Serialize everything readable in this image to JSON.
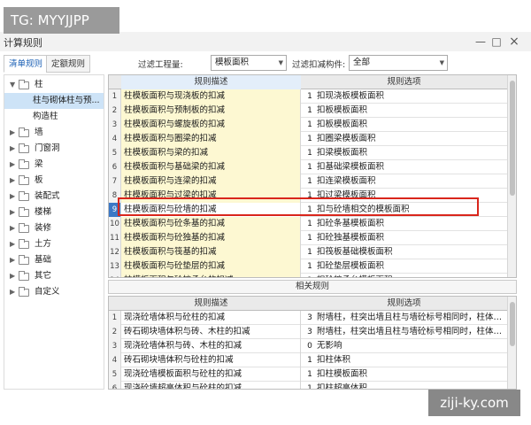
{
  "watermarks": {
    "top_left": "TG: MYYJJPP",
    "bottom_right": "ziji-ky.com"
  },
  "window": {
    "title": "计算规则",
    "minimize": "—",
    "maximize": "□",
    "close": "×"
  },
  "tabs": [
    {
      "label": "清单规则",
      "active": true
    },
    {
      "label": "定额规则",
      "active": false
    }
  ],
  "filters": {
    "project_label": "过滤工程量:",
    "project_value": "模板面积",
    "member_label": "过滤扣减构件:",
    "member_value": "全部"
  },
  "tree": [
    {
      "label": "柱",
      "expanded": true,
      "children": [
        {
          "label": "柱与砌体柱与预...",
          "selected": true
        },
        {
          "label": "构造柱"
        }
      ]
    },
    {
      "label": "墙"
    },
    {
      "label": "门窗洞"
    },
    {
      "label": "梁"
    },
    {
      "label": "板"
    },
    {
      "label": "装配式"
    },
    {
      "label": "楼梯"
    },
    {
      "label": "装修"
    },
    {
      "label": "土方"
    },
    {
      "label": "基础"
    },
    {
      "label": "其它"
    },
    {
      "label": "自定义"
    }
  ],
  "upper_grid": {
    "headers": {
      "description": "规则描述",
      "option": "规则选项"
    },
    "selected_row": 9,
    "rows": [
      {
        "num": "1",
        "desc": "柱模板面积与现浇板的扣减",
        "code": "1",
        "option": "扣现浇板模板面积"
      },
      {
        "num": "2",
        "desc": "柱模板面积与预制板的扣减",
        "code": "1",
        "option": "扣板模板面积"
      },
      {
        "num": "3",
        "desc": "柱模板面积与螺旋板的扣减",
        "code": "1",
        "option": "扣板模板面积"
      },
      {
        "num": "4",
        "desc": "柱模板面积与圈梁的扣减",
        "code": "1",
        "option": "扣圈梁模板面积"
      },
      {
        "num": "5",
        "desc": "柱模板面积与梁的扣减",
        "code": "1",
        "option": "扣梁模板面积"
      },
      {
        "num": "6",
        "desc": "柱模板面积与基础梁的扣减",
        "code": "1",
        "option": "扣基础梁模板面积"
      },
      {
        "num": "7",
        "desc": "柱模板面积与连梁的扣减",
        "code": "1",
        "option": "扣连梁模板面积"
      },
      {
        "num": "8",
        "desc": "柱模板面积与过梁的扣减",
        "code": "1",
        "option": "扣过梁模板面积"
      },
      {
        "num": "9",
        "desc": "柱模板面积与砼墙的扣减",
        "code": "1",
        "option": "扣与砼墙相交的模板面积"
      },
      {
        "num": "10",
        "desc": "柱模板面积与砼条基的扣减",
        "code": "1",
        "option": "扣砼条基模板面积"
      },
      {
        "num": "11",
        "desc": "柱模板面积与砼独基的扣减",
        "code": "1",
        "option": "扣砼独基模板面积"
      },
      {
        "num": "12",
        "desc": "柱模板面积与筏基的扣减",
        "code": "1",
        "option": "扣筏板基础模板面积"
      },
      {
        "num": "13",
        "desc": "柱模板面积与砼垫层的扣减",
        "code": "1",
        "option": "扣砼垫层模板面积"
      },
      {
        "num": "14",
        "desc": "柱模板面积与砼桩承台的扣减",
        "code": "1",
        "option": "扣砼桩承台模板面积"
      }
    ]
  },
  "related_label": "相关规则",
  "lower_grid": {
    "headers": {
      "description": "规则描述",
      "option": "规则选项"
    },
    "rows": [
      {
        "num": "1",
        "desc": "现浇砼墙体积与砼柱的扣减",
        "code": "3",
        "option": "附墙柱，柱突出墙且柱与墙砼标号相同时，柱体积并..."
      },
      {
        "num": "2",
        "desc": "砖石砌块墙体积与砖、木柱的扣减",
        "code": "3",
        "option": "附墙柱，柱突出墙且柱与墙砼标号相同时，柱体积并..."
      },
      {
        "num": "3",
        "desc": "现浇砼墙体积与砖、木柱的扣减",
        "code": "0",
        "option": "无影响"
      },
      {
        "num": "4",
        "desc": "砖石砌块墙体积与砼柱的扣减",
        "code": "1",
        "option": "扣柱体积"
      },
      {
        "num": "5",
        "desc": "现浇砼墙模板面积与砼柱的扣减",
        "code": "1",
        "option": "扣柱模板面积"
      },
      {
        "num": "6",
        "desc": "现浇砼墙超高体积与砼柱的扣减",
        "code": "1",
        "option": "扣柱超高体积"
      }
    ]
  },
  "colors": {
    "selected_row": "#3b78c6",
    "highlight_box": "#d9261c",
    "description_cell": "#fdf8d2"
  }
}
